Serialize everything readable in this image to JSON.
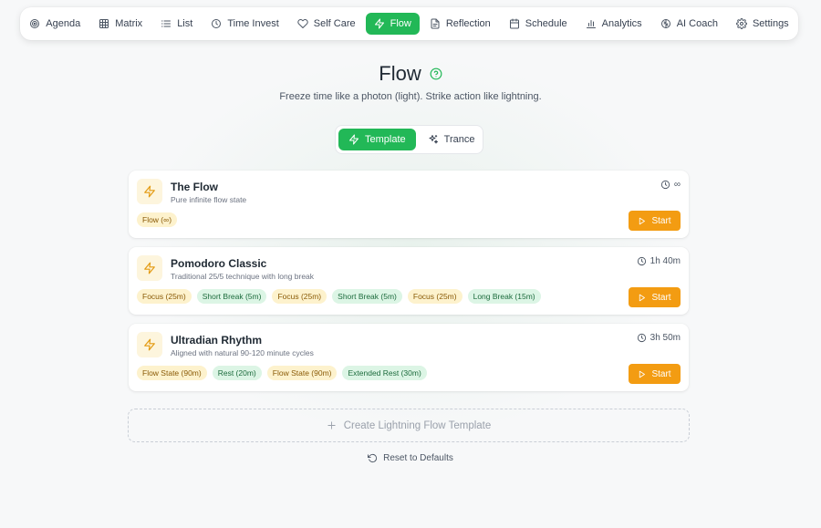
{
  "nav": {
    "items": [
      {
        "label": "Agenda",
        "icon": "target-icon"
      },
      {
        "label": "Matrix",
        "icon": "grid-icon"
      },
      {
        "label": "List",
        "icon": "list-icon"
      },
      {
        "label": "Time Invest",
        "icon": "clock-icon"
      },
      {
        "label": "Self Care",
        "icon": "heart-icon"
      },
      {
        "label": "Flow",
        "icon": "lightning-icon",
        "active": true
      },
      {
        "label": "Reflection",
        "icon": "document-icon"
      },
      {
        "label": "Schedule",
        "icon": "calendar-icon"
      },
      {
        "label": "Analytics",
        "icon": "bar-chart-icon"
      },
      {
        "label": "AI Coach",
        "icon": "brain-icon"
      },
      {
        "label": "Settings",
        "icon": "gear-icon"
      }
    ]
  },
  "header": {
    "title": "Flow",
    "subtitle": "Freeze time like a photon (light). Strike action like lightning."
  },
  "mode_toggle": {
    "template_label": "Template",
    "trance_label": "Trance",
    "active": "Template"
  },
  "templates": [
    {
      "name": "The Flow",
      "description": "Pure infinite flow state",
      "duration": "∞",
      "phases": [
        {
          "label": "Flow (∞)",
          "kind": "focus"
        }
      ],
      "start_label": "Start"
    },
    {
      "name": "Pomodoro Classic",
      "description": "Traditional 25/5 technique with long break",
      "duration": "1h 40m",
      "phases": [
        {
          "label": "Focus (25m)",
          "kind": "focus"
        },
        {
          "label": "Short Break (5m)",
          "kind": "rest"
        },
        {
          "label": "Focus (25m)",
          "kind": "focus"
        },
        {
          "label": "Short Break (5m)",
          "kind": "rest"
        },
        {
          "label": "Focus (25m)",
          "kind": "focus"
        },
        {
          "label": "Long Break (15m)",
          "kind": "rest"
        }
      ],
      "start_label": "Start"
    },
    {
      "name": "Ultradian Rhythm",
      "description": "Aligned with natural 90-120 minute cycles",
      "duration": "3h 50m",
      "phases": [
        {
          "label": "Flow State (90m)",
          "kind": "focus"
        },
        {
          "label": "Rest (20m)",
          "kind": "rest"
        },
        {
          "label": "Flow State (90m)",
          "kind": "focus"
        },
        {
          "label": "Extended Rest (30m)",
          "kind": "rest"
        }
      ],
      "start_label": "Start"
    }
  ],
  "create_label": "Create Lightning Flow Template",
  "reset_label": "Reset to Defaults",
  "colors": {
    "accent_green": "#22b857",
    "start_orange": "#f39c12",
    "focus_badge_bg": "#fdf2cd",
    "rest_badge_bg": "#dcf5e5"
  }
}
